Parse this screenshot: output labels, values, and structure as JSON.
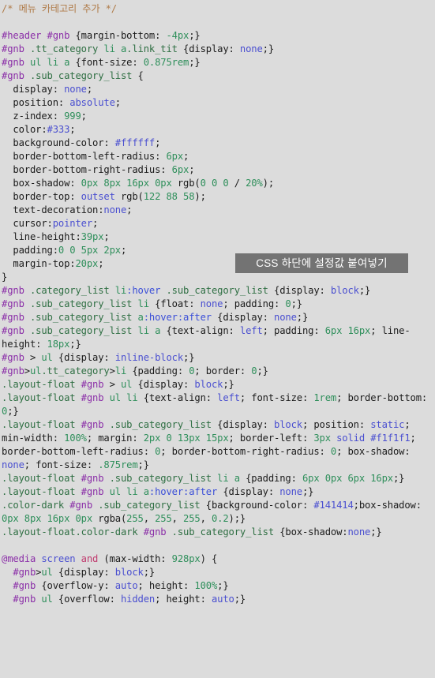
{
  "editor": {
    "background_color": "#dcdcdc",
    "language": "css",
    "lines": [
      "/* 메뉴 카테고리 추가 */",
      "",
      "#header #gnb {margin-bottom: -4px;}",
      "#gnb .tt_category li a.link_tit {display: none;}",
      "#gnb ul li a {font-size: 0.875rem;}",
      "#gnb .sub_category_list {",
      "  display: none;",
      "  position: absolute;",
      "  z-index: 999;",
      "  color:#333;",
      "  background-color: #ffffff;",
      "  border-bottom-left-radius: 6px;",
      "  border-bottom-right-radius: 6px;",
      "  box-shadow: 0px 8px 16px 0px rgb(0 0 0 / 20%);",
      "  border-top: outset rgb(122 88 58);",
      "  text-decoration:none;",
      "  cursor:pointer;",
      "  line-height:39px;",
      "  padding:0 0 5px 2px;",
      "  margin-top:20px;",
      "}",
      "#gnb .category_list li:hover .sub_category_list {display: block;}",
      "#gnb .sub_category_list li {float: none; padding: 0;}",
      "#gnb .sub_category_list a:hover:after {display: none;}",
      "#gnb .sub_category_list li a {text-align: left; padding: 6px 16px; line-height: 18px;}",
      "#gnb > ul {display: inline-block;}",
      "#gnb>ul.tt_category>li {padding: 0; border: 0;}",
      ".layout-float #gnb > ul {display: block;}",
      ".layout-float #gnb ul li {text-align: left; font-size: 1rem; border-bottom: 0;}",
      ".layout-float #gnb .sub_category_list {display: block; position: static; min-width: 100%; margin: 2px 0 13px 15px; border-left: 3px solid #f1f1f1;  border-bottom-left-radius: 0; border-bottom-right-radius: 0; box-shadow: none; font-size: .875rem;}",
      ".layout-float #gnb .sub_category_list li a {padding: 6px 0px 6px 16px;}",
      ".layout-float #gnb ul li a:hover:after {display: none;}",
      ".color-dark #gnb .sub_category_list {background-color: #141414;box-shadow: 0px 8px 16px 0px rgba(255, 255, 255, 0.2);}",
      ".layout-float.color-dark #gnb .sub_category_list {box-shadow:none;}",
      "",
      "@media screen and (max-width: 928px) {",
      "  #gnb>ul {display: block;}",
      "  #gnb {overflow-y: auto; height: 100%;}",
      "  #gnb ul {overflow: hidden; height: auto;}"
    ]
  },
  "overlay": {
    "badge_text": "CSS 하단에 설정값 붙여넣기",
    "badge_background": "#737373",
    "badge_text_color": "#ffffff"
  },
  "syntax_colors": {
    "comment": "#b07c4a",
    "id_selector": "#8b2fa8",
    "class_selector": "#2f6f43",
    "element_selector": "#2f8f5b",
    "pseudo_class": "#3b4fd8",
    "property": "#1b1b1b",
    "number": "#2f8f5b",
    "keyword": "#4a4fd0",
    "hex_color": "#4a4fd0",
    "at_rule": "#8b2fa8"
  }
}
